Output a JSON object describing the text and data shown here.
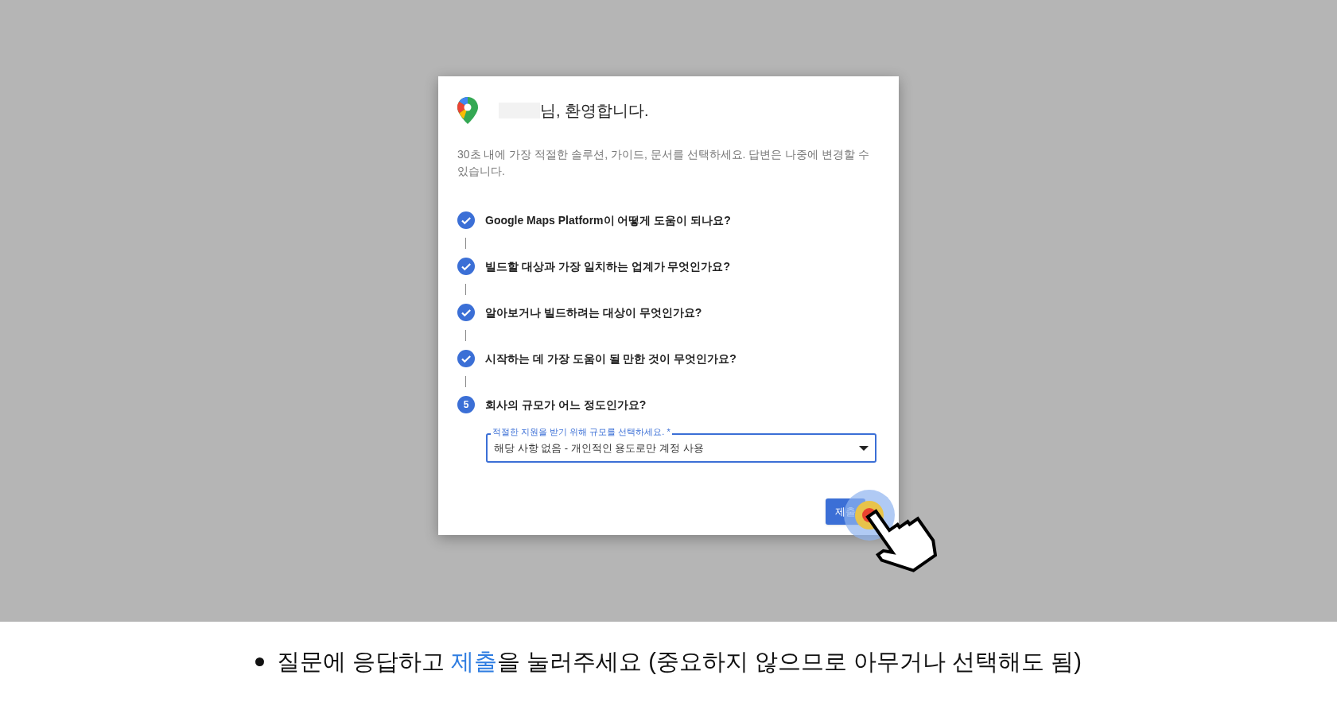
{
  "dialog": {
    "title": "님, 환영합니다.",
    "intro": "30초 내에 가장 적절한 솔루션, 가이드, 문서를 선택하세요. 답변은 나중에 변경할 수 있습니다.",
    "steps": [
      {
        "kind": "done",
        "question": "Google Maps Platform이 어떻게 도움이 되나요?"
      },
      {
        "kind": "done",
        "question": "빌드할 대상과 가장 일치하는 업계가 무엇인가요?"
      },
      {
        "kind": "done",
        "question": "알아보거나 빌드하려는 대상이 무엇인가요?"
      },
      {
        "kind": "done",
        "question": "시작하는 데 가장 도움이 될 만한 것이 무엇인가요?"
      },
      {
        "kind": "current",
        "number": "5",
        "question": "회사의 규모가 어느 정도인가요?"
      }
    ],
    "select": {
      "label": "적절한 지원을 받기 위해 규모를 선택하세요. *",
      "value": "해당 사항 없음 - 개인적인 용도로만 계정 사용"
    },
    "submit": "제출"
  },
  "caption": {
    "before": "질문에 응답하고 ",
    "highlight": "제출",
    "after": "을 눌러주세요 (중요하지 않으므로 아무거나 선택해도 됨)"
  }
}
